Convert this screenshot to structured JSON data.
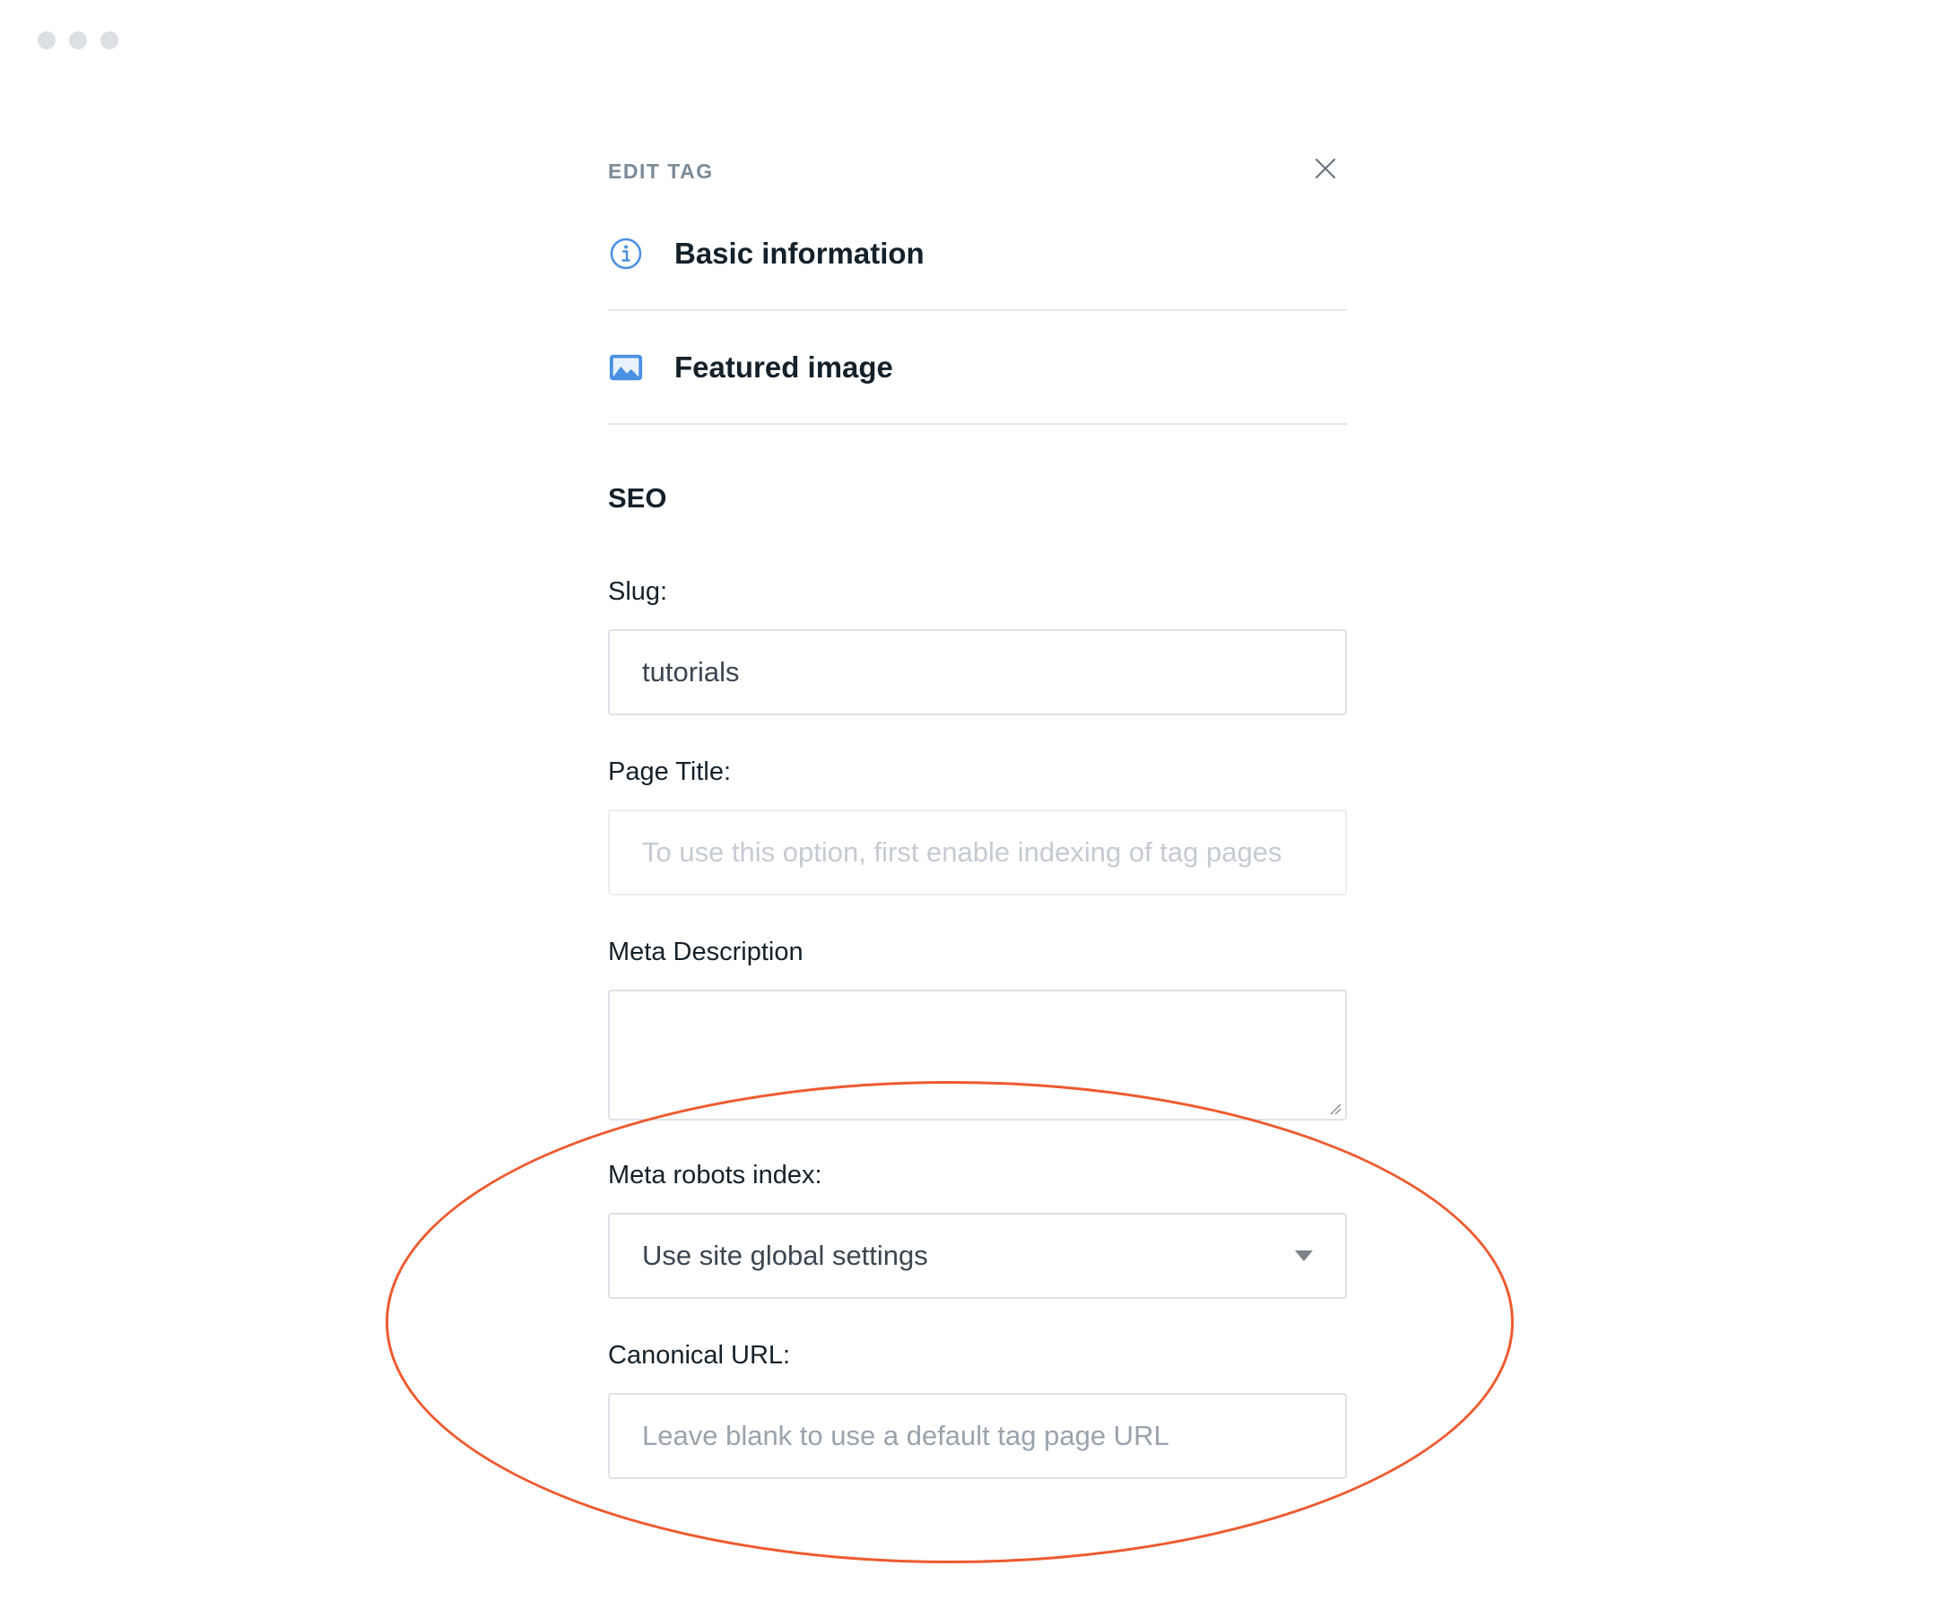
{
  "window": {
    "controls": [
      "dot",
      "dot",
      "dot"
    ]
  },
  "panel": {
    "title": "EDIT TAG",
    "close_icon": "close-icon"
  },
  "sections": [
    {
      "label": "Basic information",
      "icon": "info-icon",
      "icon_color": "#4a90e2"
    },
    {
      "label": "Featured image",
      "icon": "image-icon",
      "icon_color": "#4a90e2"
    }
  ],
  "seo": {
    "title": "SEO",
    "slug": {
      "label": "Slug:",
      "value": "tutorials"
    },
    "page_title": {
      "label": "Page Title:",
      "placeholder": "To use this option, first enable indexing of tag pages"
    },
    "meta_description": {
      "label": "Meta Description",
      "value": ""
    },
    "meta_robots": {
      "label": "Meta robots index:",
      "selected": "Use site global settings"
    },
    "canonical_url": {
      "label": "Canonical URL:",
      "placeholder": "Leave blank to use a default tag page URL"
    }
  },
  "annotation": {
    "highlight_color": "#ee5a2f"
  }
}
